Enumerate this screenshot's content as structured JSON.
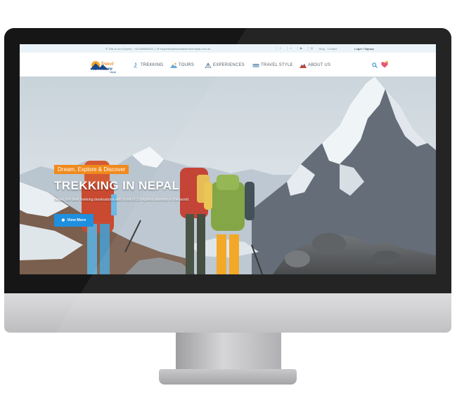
{
  "topbar": {
    "phone": "Talk to our Experts : +61449669326",
    "email": "enquiries@traveladventurenepal.com.au",
    "social_icons": [
      "facebook-icon",
      "twitter-icon",
      "youtube-icon",
      "instagram-icon"
    ],
    "social_glyphs": [
      "f",
      "t",
      "▶",
      "◎"
    ],
    "blog": "Blog",
    "contact": "Contact",
    "login": "Login / Signup"
  },
  "logo": {
    "line1": "Travel",
    "line2": "Adventure",
    "line3": "Nepal"
  },
  "nav": {
    "items": [
      {
        "label": "TREKKING",
        "icon": "hiker-icon"
      },
      {
        "label": "TOURS",
        "icon": "mountain-sun-icon"
      },
      {
        "label": "EXPERIENCES",
        "icon": "tent-icon"
      },
      {
        "label": "TRAVEL STYLE",
        "icon": "bridge-icon"
      },
      {
        "label": "ABOUT US",
        "icon": "nepal-flag-icon"
      }
    ]
  },
  "hero": {
    "tagline": "Dream, Explore & Discover",
    "title": "TREKKING IN NEPAL",
    "subtitle": "Nepal, the best trekking destinations with 8 out of 10 highest summits in the world",
    "button": "View More"
  },
  "colors": {
    "accent_orange": "#f08a1c",
    "button_blue": "#1f8fe0",
    "topbar_bg": "#e9f3f9"
  }
}
